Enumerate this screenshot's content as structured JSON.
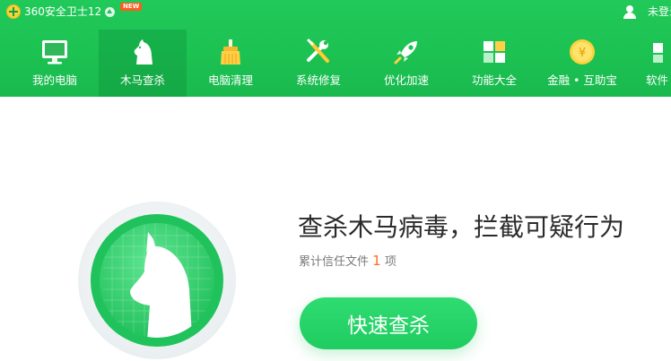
{
  "app": {
    "title": "360安全卫士12",
    "new_badge": "NEW"
  },
  "user": {
    "label": "未登录",
    "icon": "user-icon"
  },
  "nav": {
    "items": [
      {
        "label": "我的电脑",
        "icon": "monitor-icon",
        "active": false
      },
      {
        "label": "木马查杀",
        "icon": "horse-icon",
        "active": true
      },
      {
        "label": "电脑清理",
        "icon": "broom-icon",
        "active": false
      },
      {
        "label": "系统修复",
        "icon": "wrench-screwdriver-icon",
        "active": false
      },
      {
        "label": "优化加速",
        "icon": "rocket-icon",
        "active": false
      },
      {
        "label": "功能大全",
        "icon": "grid-icon",
        "active": false
      },
      {
        "label": "金融 • 互助宝",
        "icon": "yuan-coin-icon",
        "active": false
      },
      {
        "label": "软件",
        "icon": "software-icon",
        "active": false
      }
    ]
  },
  "hero": {
    "title": "查杀木马病毒，拦截可疑行为",
    "subtitle_prefix": "累计信任文件",
    "trusted_count": "1",
    "subtitle_suffix": "项",
    "button": "快速查杀",
    "coin_symbol": "¥"
  },
  "colors": {
    "brand_green": "#1cc252",
    "accent_orange": "#ff6a2b"
  }
}
